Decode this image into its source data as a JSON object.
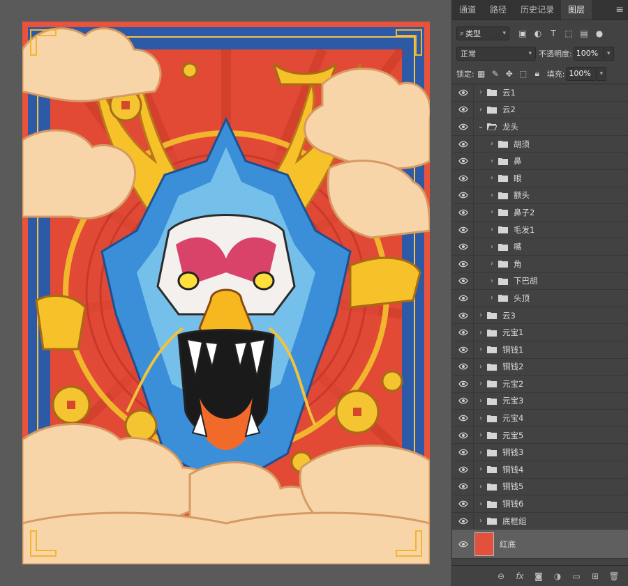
{
  "panel": {
    "tabs": [
      {
        "label": "通道",
        "active": false
      },
      {
        "label": "路径",
        "active": false
      },
      {
        "label": "历史记录",
        "active": false
      },
      {
        "label": "图层",
        "active": true
      }
    ],
    "filter_label": "类型",
    "blend_mode": "正常",
    "opacity_label": "不透明度:",
    "opacity_value": "100%",
    "lock_label": "锁定:",
    "fill_label": "填充:",
    "fill_value": "100%"
  },
  "layers": [
    {
      "name": "云1",
      "depth": 0,
      "expanded": false
    },
    {
      "name": "云2",
      "depth": 0,
      "expanded": false
    },
    {
      "name": "龙头",
      "depth": 0,
      "expanded": true
    },
    {
      "name": "胡须",
      "depth": 1,
      "expanded": false
    },
    {
      "name": "鼻",
      "depth": 1,
      "expanded": false
    },
    {
      "name": "眼",
      "depth": 1,
      "expanded": false
    },
    {
      "name": "额头",
      "depth": 1,
      "expanded": false
    },
    {
      "name": "鼻子2",
      "depth": 1,
      "expanded": false
    },
    {
      "name": "毛发1",
      "depth": 1,
      "expanded": false
    },
    {
      "name": "嘴",
      "depth": 1,
      "expanded": false
    },
    {
      "name": "角",
      "depth": 1,
      "expanded": false
    },
    {
      "name": "下巴胡",
      "depth": 1,
      "expanded": false
    },
    {
      "name": "头顶",
      "depth": 1,
      "expanded": false
    },
    {
      "name": "云3",
      "depth": 0,
      "expanded": false
    },
    {
      "name": "元宝1",
      "depth": 0,
      "expanded": false
    },
    {
      "name": "铜钱1",
      "depth": 0,
      "expanded": false
    },
    {
      "name": "铜钱2",
      "depth": 0,
      "expanded": false
    },
    {
      "name": "元宝2",
      "depth": 0,
      "expanded": false
    },
    {
      "name": "元宝3",
      "depth": 0,
      "expanded": false
    },
    {
      "name": "元宝4",
      "depth": 0,
      "expanded": false
    },
    {
      "name": "元宝5",
      "depth": 0,
      "expanded": false
    },
    {
      "name": "铜钱3",
      "depth": 0,
      "expanded": false
    },
    {
      "name": "铜钱4",
      "depth": 0,
      "expanded": false
    },
    {
      "name": "铜钱5",
      "depth": 0,
      "expanded": false
    },
    {
      "name": "铜钱6",
      "depth": 0,
      "expanded": false
    },
    {
      "name": "底框组",
      "depth": 0,
      "expanded": false
    }
  ],
  "selected_layer": {
    "name": "红底",
    "color": "#e3503c"
  },
  "colors": {
    "artboard_red": "#e9533c",
    "frame_blue": "#2e5ea8",
    "cloud": "#f6d2a6",
    "gold": "#f7b81f",
    "dragon_blue": "#3a8fd8",
    "dragon_pink": "#d9436a"
  }
}
